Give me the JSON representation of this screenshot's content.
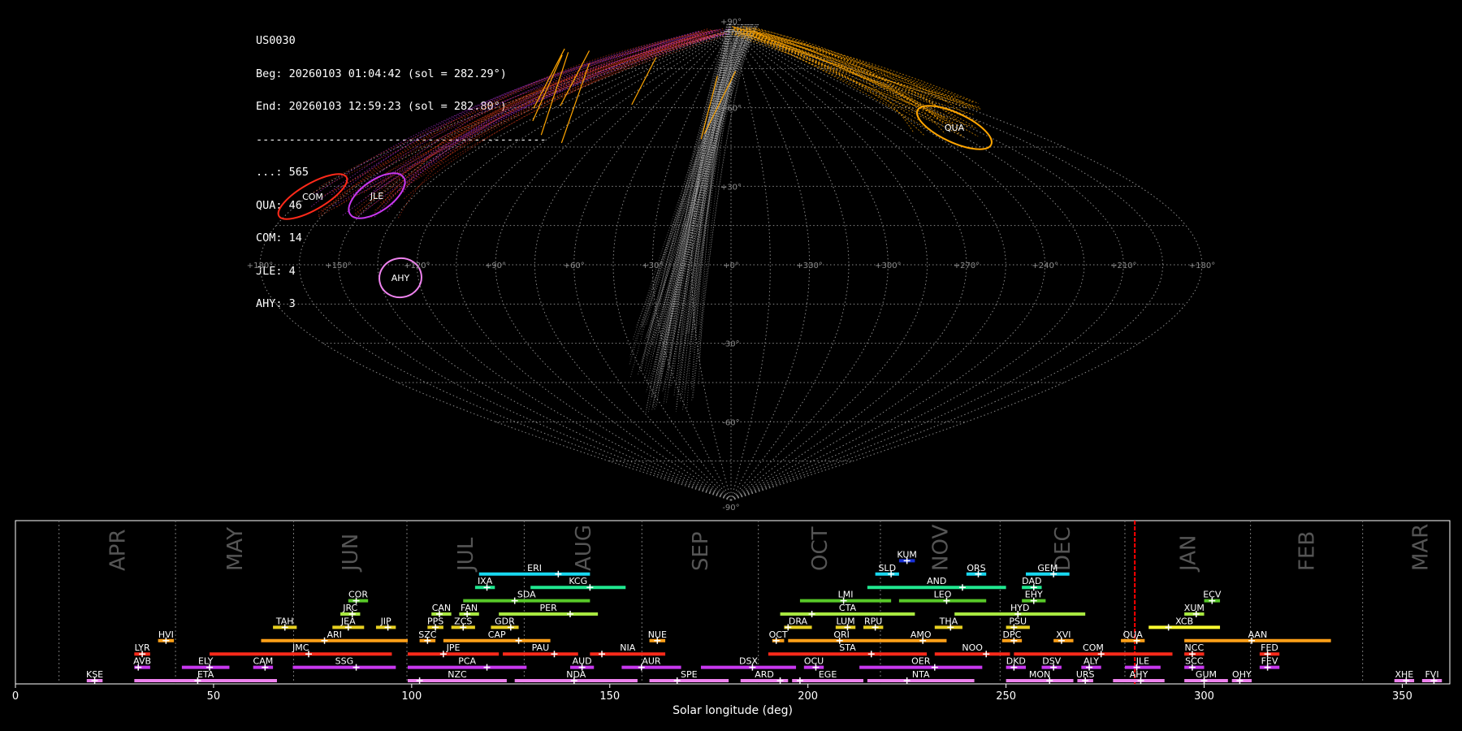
{
  "stats": {
    "station": "US0030",
    "begin": "Beg: 20260103 01:04:42 (sol = 282.29°)",
    "end": "End: 20260103 12:59:23 (sol = 282.80°)",
    "separator": "--------------------------------------------",
    "counts": [
      "...: 565",
      "QUA: 46",
      "COM: 14",
      "JLE: 4",
      "AHY: 3"
    ]
  },
  "colors": {
    "background": "#000000",
    "sporadic": "#bdbdbd",
    "QUA": "#ffa500",
    "COM": "#ff2a1a",
    "JLE": "#c838f0",
    "AHY": "#ee82ee",
    "current_sol": "#ff0000"
  },
  "chart_data": [
    {
      "type": "scatter",
      "projection": "sinusoidal",
      "lon_labels": [
        "+180°",
        "+150°",
        "+120°",
        "+90°",
        "+60°",
        "+30°",
        "+0°",
        "+330°",
        "+300°",
        "+270°",
        "+240°",
        "+210°",
        "+180°"
      ],
      "lat_labels": [
        "+90°",
        "+60°",
        "+30°",
        "-30°",
        "-60°",
        "-90°"
      ],
      "grid": true,
      "radiants": [
        {
          "code": "QUA",
          "lon": 230,
          "lat": 49
        },
        {
          "code": "COM",
          "lon": 150,
          "lat": 24
        },
        {
          "code": "JLE",
          "lon": 133,
          "lat": 24
        },
        {
          "code": "AHY",
          "lon": 131,
          "lat": -4
        }
      ]
    },
    {
      "type": "bar",
      "xlabel": "Solar longitude (deg)",
      "xlim": [
        0,
        362
      ],
      "xticks": [
        0,
        50,
        100,
        150,
        200,
        250,
        300,
        350
      ],
      "current_sol": 282.5,
      "months": [
        {
          "name": "APR",
          "start": 11
        },
        {
          "name": "MAY",
          "start": 40.4
        },
        {
          "name": "JUN",
          "start": 70.2
        },
        {
          "name": "JUL",
          "start": 98.8
        },
        {
          "name": "AUG",
          "start": 128.4
        },
        {
          "name": "SEP",
          "start": 158.1
        },
        {
          "name": "OCT",
          "start": 187.5
        },
        {
          "name": "NOV",
          "start": 218.3
        },
        {
          "name": "DEC",
          "start": 248.5
        },
        {
          "name": "JAN",
          "start": 280
        },
        {
          "name": "FEB",
          "start": 311.7
        },
        {
          "name": "MAR",
          "start": 340
        }
      ],
      "showers": [
        {
          "code": "KUM",
          "start": 223,
          "end": 227,
          "peak": 225,
          "row": 10,
          "color": "#1830d8"
        },
        {
          "code": "ERI",
          "start": 117,
          "end": 145,
          "peak": 137,
          "row": 9,
          "color": "#18d8f0"
        },
        {
          "code": "SLD",
          "start": 217,
          "end": 223,
          "peak": 221,
          "row": 9,
          "color": "#18d8f0"
        },
        {
          "code": "ORS",
          "start": 240,
          "end": 245,
          "peak": 243,
          "row": 9,
          "color": "#18d8f0"
        },
        {
          "code": "GEM",
          "start": 255,
          "end": 266,
          "peak": 262,
          "row": 9,
          "color": "#18d8f0"
        },
        {
          "code": "IXA",
          "start": 116,
          "end": 121,
          "peak": 119,
          "row": 8,
          "color": "#20e890"
        },
        {
          "code": "KCG",
          "start": 130,
          "end": 154,
          "peak": 145,
          "row": 8,
          "color": "#20e890"
        },
        {
          "code": "AND",
          "start": 215,
          "end": 250,
          "peak": 239,
          "row": 8,
          "color": "#20e890"
        },
        {
          "code": "DAD",
          "start": 254,
          "end": 259,
          "peak": 257,
          "row": 8,
          "color": "#20e890"
        },
        {
          "code": "COR",
          "start": 84,
          "end": 89,
          "peak": 86,
          "row": 7,
          "color": "#58c828"
        },
        {
          "code": "SDA",
          "start": 113,
          "end": 145,
          "peak": 126,
          "row": 7,
          "color": "#58c828"
        },
        {
          "code": "LMI",
          "start": 198,
          "end": 221,
          "peak": 209,
          "row": 7,
          "color": "#58c828"
        },
        {
          "code": "LEO",
          "start": 223,
          "end": 245,
          "peak": 235,
          "row": 7,
          "color": "#58c828"
        },
        {
          "code": "EHY",
          "start": 254,
          "end": 260,
          "peak": 257,
          "row": 7,
          "color": "#58c828"
        },
        {
          "code": "ECV",
          "start": 300,
          "end": 304,
          "peak": 302,
          "row": 7,
          "color": "#58c828"
        },
        {
          "code": "JRC",
          "start": 82,
          "end": 87,
          "peak": 85,
          "row": 6,
          "color": "#a8e840"
        },
        {
          "code": "CAN",
          "start": 105,
          "end": 110,
          "peak": 107,
          "row": 6,
          "color": "#a8e840"
        },
        {
          "code": "FAN",
          "start": 112,
          "end": 117,
          "peak": 114,
          "row": 6,
          "color": "#a8e840"
        },
        {
          "code": "PER",
          "start": 122,
          "end": 147,
          "peak": 140,
          "row": 6,
          "color": "#a8e840"
        },
        {
          "code": "CTA",
          "start": 193,
          "end": 227,
          "peak": 201,
          "row": 6,
          "color": "#a8e840"
        },
        {
          "code": "HYD",
          "start": 237,
          "end": 270,
          "peak": 253,
          "row": 6,
          "color": "#a8e840"
        },
        {
          "code": "XUM",
          "start": 295,
          "end": 300,
          "peak": 298,
          "row": 6,
          "color": "#a8e840"
        },
        {
          "code": "TAH",
          "start": 65,
          "end": 71,
          "peak": 68,
          "row": 5,
          "color": "#e8d020"
        },
        {
          "code": "JEA",
          "start": 80,
          "end": 88,
          "peak": 84,
          "row": 5,
          "color": "#e8d020"
        },
        {
          "code": "JIP",
          "start": 91,
          "end": 96,
          "peak": 94,
          "row": 5,
          "color": "#e8d020"
        },
        {
          "code": "PPS",
          "start": 104,
          "end": 108,
          "peak": 106,
          "row": 5,
          "color": "#e8d020"
        },
        {
          "code": "ZCS",
          "start": 110,
          "end": 116,
          "peak": 113,
          "row": 5,
          "color": "#e8d020"
        },
        {
          "code": "GDR",
          "start": 120,
          "end": 127,
          "peak": 125,
          "row": 5,
          "color": "#e8d020"
        },
        {
          "code": "DRA",
          "start": 194,
          "end": 201,
          "peak": 195,
          "row": 5,
          "color": "#e8d020"
        },
        {
          "code": "LUM",
          "start": 207,
          "end": 212,
          "peak": 210,
          "row": 5,
          "color": "#e8d020"
        },
        {
          "code": "RPU",
          "start": 214,
          "end": 219,
          "peak": 217,
          "row": 5,
          "color": "#e8d020"
        },
        {
          "code": "THA",
          "start": 232,
          "end": 239,
          "peak": 236,
          "row": 5,
          "color": "#e8d020"
        },
        {
          "code": "PSU",
          "start": 250,
          "end": 256,
          "peak": 252,
          "row": 5,
          "color": "#e8d020"
        },
        {
          "code": "XCB",
          "start": 286,
          "end": 304,
          "peak": 291,
          "row": 5,
          "color": "#ffff30"
        },
        {
          "code": "HVI",
          "start": 36,
          "end": 40,
          "peak": 38,
          "row": 4,
          "color": "#ffa018"
        },
        {
          "code": "ARI",
          "start": 62,
          "end": 99,
          "peak": 78,
          "row": 4,
          "color": "#ffa018"
        },
        {
          "code": "SZC",
          "start": 102,
          "end": 106,
          "peak": 104,
          "row": 4,
          "color": "#ffa018"
        },
        {
          "code": "CAP",
          "start": 108,
          "end": 135,
          "peak": 127,
          "row": 4,
          "color": "#ffa018"
        },
        {
          "code": "NUE",
          "start": 160,
          "end": 164,
          "peak": 162,
          "row": 4,
          "color": "#ffa018"
        },
        {
          "code": "OCT",
          "start": 191,
          "end": 194,
          "peak": 192,
          "row": 4,
          "color": "#ffa018"
        },
        {
          "code": "ORI",
          "start": 195,
          "end": 222,
          "peak": 208,
          "row": 4,
          "color": "#ffa018"
        },
        {
          "code": "AMO",
          "start": 222,
          "end": 235,
          "peak": 229,
          "row": 4,
          "color": "#ffa018"
        },
        {
          "code": "DPC",
          "start": 249,
          "end": 254,
          "peak": 252,
          "row": 4,
          "color": "#ffa018"
        },
        {
          "code": "XVI",
          "start": 262,
          "end": 267,
          "peak": 264,
          "row": 4,
          "color": "#ffa018"
        },
        {
          "code": "QUA",
          "start": 279,
          "end": 285,
          "peak": 283,
          "row": 4,
          "color": "#ffa018"
        },
        {
          "code": "AAN",
          "start": 295,
          "end": 332,
          "peak": 312,
          "row": 4,
          "color": "#ffa018"
        },
        {
          "code": "LYR",
          "start": 30,
          "end": 34,
          "peak": 32,
          "row": 3,
          "color": "#ff2a1a"
        },
        {
          "code": "JMC",
          "start": 49,
          "end": 95,
          "peak": 74,
          "row": 3,
          "color": "#ff2a1a"
        },
        {
          "code": "JPE",
          "start": 99,
          "end": 122,
          "peak": 108,
          "row": 3,
          "color": "#ff2a1a"
        },
        {
          "code": "PAU",
          "start": 123,
          "end": 142,
          "peak": 136,
          "row": 3,
          "color": "#ff2a1a"
        },
        {
          "code": "NIA",
          "start": 145,
          "end": 164,
          "peak": 148,
          "row": 3,
          "color": "#ff2a1a"
        },
        {
          "code": "STA",
          "start": 190,
          "end": 230,
          "peak": 216,
          "row": 3,
          "color": "#ff2a1a"
        },
        {
          "code": "NOO",
          "start": 232,
          "end": 251,
          "peak": 245,
          "row": 3,
          "color": "#ff2a1a"
        },
        {
          "code": "COM",
          "start": 252,
          "end": 292,
          "peak": 274,
          "row": 3,
          "color": "#ff2a1a"
        },
        {
          "code": "NCC",
          "start": 295,
          "end": 300,
          "peak": 297,
          "row": 3,
          "color": "#ff2a1a"
        },
        {
          "code": "FED",
          "start": 314,
          "end": 319,
          "peak": 316,
          "row": 3,
          "color": "#ff2a1a"
        },
        {
          "code": "AVB",
          "start": 30,
          "end": 34,
          "peak": 31,
          "row": 2,
          "color": "#c838f0"
        },
        {
          "code": "ELY",
          "start": 42,
          "end": 54,
          "peak": 49,
          "row": 2,
          "color": "#c838f0"
        },
        {
          "code": "CAM",
          "start": 60,
          "end": 65,
          "peak": 63,
          "row": 2,
          "color": "#c838f0"
        },
        {
          "code": "SSG",
          "start": 70,
          "end": 96,
          "peak": 86,
          "row": 2,
          "color": "#c838f0"
        },
        {
          "code": "PCA",
          "start": 99,
          "end": 129,
          "peak": 119,
          "row": 2,
          "color": "#c838f0"
        },
        {
          "code": "AUD",
          "start": 140,
          "end": 146,
          "peak": 143,
          "row": 2,
          "color": "#c838f0"
        },
        {
          "code": "AUR",
          "start": 153,
          "end": 168,
          "peak": 158,
          "row": 2,
          "color": "#c838f0"
        },
        {
          "code": "DSX",
          "start": 173,
          "end": 197,
          "peak": 186,
          "row": 2,
          "color": "#c838f0"
        },
        {
          "code": "OCU",
          "start": 199,
          "end": 204,
          "peak": 202,
          "row": 2,
          "color": "#c838f0"
        },
        {
          "code": "OER",
          "start": 213,
          "end": 244,
          "peak": 232,
          "row": 2,
          "color": "#c838f0"
        },
        {
          "code": "DKD",
          "start": 250,
          "end": 255,
          "peak": 252,
          "row": 2,
          "color": "#c838f0"
        },
        {
          "code": "DSV",
          "start": 259,
          "end": 264,
          "peak": 262,
          "row": 2,
          "color": "#c838f0"
        },
        {
          "code": "ALY",
          "start": 269,
          "end": 274,
          "peak": 271,
          "row": 2,
          "color": "#c838f0"
        },
        {
          "code": "JLE",
          "start": 280,
          "end": 289,
          "peak": 283,
          "row": 2,
          "color": "#c838f0"
        },
        {
          "code": "SCC",
          "start": 295,
          "end": 300,
          "peak": 297,
          "row": 2,
          "color": "#c838f0"
        },
        {
          "code": "FEV",
          "start": 314,
          "end": 319,
          "peak": 316,
          "row": 2,
          "color": "#c838f0"
        },
        {
          "code": "KSE",
          "start": 18,
          "end": 22,
          "peak": 20,
          "row": 1,
          "color": "#ee82ee"
        },
        {
          "code": "ETA",
          "start": 30,
          "end": 66,
          "peak": 46,
          "row": 1,
          "color": "#ee82ee"
        },
        {
          "code": "NZC",
          "start": 99,
          "end": 124,
          "peak": 102,
          "row": 1,
          "color": "#ee82ee"
        },
        {
          "code": "NDA",
          "start": 126,
          "end": 157,
          "peak": 141,
          "row": 1,
          "color": "#ee82ee"
        },
        {
          "code": "SPE",
          "start": 160,
          "end": 180,
          "peak": 167,
          "row": 1,
          "color": "#ee82ee"
        },
        {
          "code": "ARD",
          "start": 183,
          "end": 195,
          "peak": 193,
          "row": 1,
          "color": "#ee82ee"
        },
        {
          "code": "EGE",
          "start": 196,
          "end": 214,
          "peak": 198,
          "row": 1,
          "color": "#ee82ee"
        },
        {
          "code": "NTA",
          "start": 215,
          "end": 242,
          "peak": 225,
          "row": 1,
          "color": "#ee82ee"
        },
        {
          "code": "MON",
          "start": 250,
          "end": 267,
          "peak": 261,
          "row": 1,
          "color": "#ee82ee"
        },
        {
          "code": "URS",
          "start": 268,
          "end": 272,
          "peak": 270,
          "row": 1,
          "color": "#ee82ee"
        },
        {
          "code": "AHY",
          "start": 277,
          "end": 290,
          "peak": 284,
          "row": 1,
          "color": "#ee82ee"
        },
        {
          "code": "GUM",
          "start": 295,
          "end": 306,
          "peak": 300,
          "row": 1,
          "color": "#ee82ee"
        },
        {
          "code": "OHY",
          "start": 307,
          "end": 312,
          "peak": 309,
          "row": 1,
          "color": "#ee82ee"
        },
        {
          "code": "XHE",
          "start": 348,
          "end": 353,
          "peak": 351,
          "row": 1,
          "color": "#ee82ee"
        },
        {
          "code": "FVI",
          "start": 355,
          "end": 360,
          "peak": 358,
          "row": 1,
          "color": "#ee82ee"
        }
      ]
    }
  ]
}
